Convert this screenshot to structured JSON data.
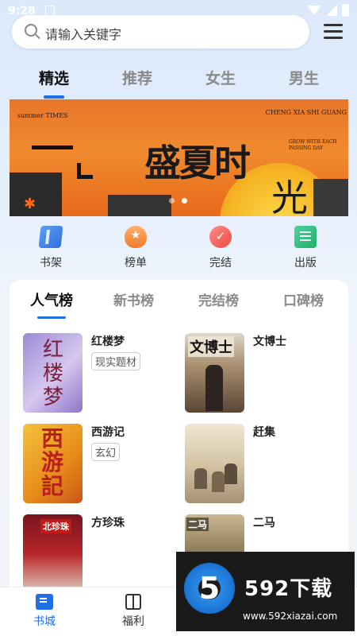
{
  "status_bar": {
    "time": "9:28"
  },
  "search": {
    "placeholder": "请输入关键字"
  },
  "tabs": [
    {
      "label": "精选",
      "active": true
    },
    {
      "label": "推荐",
      "active": false
    },
    {
      "label": "女生",
      "active": false
    },
    {
      "label": "男生",
      "active": false
    }
  ],
  "banner": {
    "title_main": "盛夏时",
    "title_second": "光",
    "small_left": "summer TIMES",
    "small_right": "CHENG XIA SHI GUANG",
    "small_mid": "GROW WITH EACH PASSING DAY",
    "carousel_total": 2,
    "carousel_active": 2
  },
  "quick_nav": [
    {
      "label": "书架",
      "icon": "bookshelf-icon"
    },
    {
      "label": "榜单",
      "icon": "ranking-icon"
    },
    {
      "label": "完结",
      "icon": "finished-icon"
    },
    {
      "label": "出版",
      "icon": "publish-icon"
    }
  ],
  "rank_tabs": [
    {
      "label": "人气榜",
      "active": true
    },
    {
      "label": "新书榜",
      "active": false
    },
    {
      "label": "完结榜",
      "active": false
    },
    {
      "label": "口碑榜",
      "active": false
    }
  ],
  "books": [
    {
      "title": "红楼梦",
      "tag": "现实题材",
      "cover_text": "红楼梦"
    },
    {
      "title": "文博士",
      "tag": "",
      "cover_text": "文博士"
    },
    {
      "title": "西游记",
      "tag": "玄幻",
      "cover_text": "西游記"
    },
    {
      "title": "赶集",
      "tag": "",
      "cover_text": ""
    },
    {
      "title": "方珍珠",
      "tag": "",
      "cover_text": "北珍珠"
    },
    {
      "title": "二马",
      "tag": "",
      "cover_text": "二马"
    }
  ],
  "bottom_nav": [
    {
      "label": "书城",
      "icon": "book-icon",
      "active": true
    },
    {
      "label": "福利",
      "icon": "gift-icon",
      "active": false
    }
  ],
  "watermark": {
    "logo": "5",
    "title": "592下载",
    "url": "www.592xiazai.com"
  },
  "colors": {
    "accent": "#1f6fe5",
    "banner_orange": "#e8762a"
  }
}
